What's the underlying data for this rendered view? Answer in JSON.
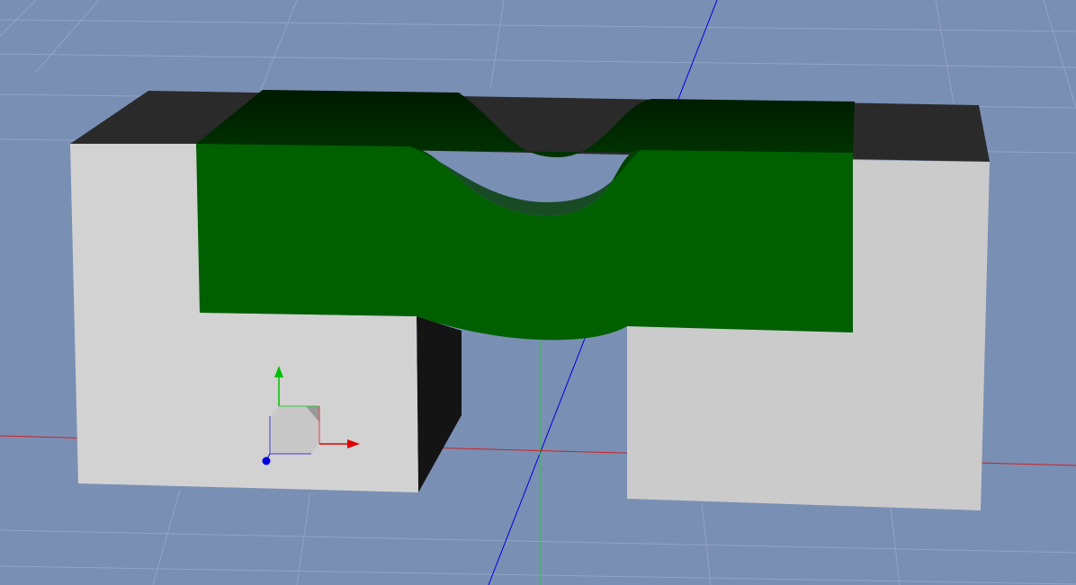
{
  "viewport": {
    "background_color": "#7a8fb4",
    "grid_color": "#93a5c4",
    "colors": {
      "block_face": "#d0d0d0",
      "block_top": "#2a2a2a",
      "block_side": "#141414",
      "part_front": "#006000",
      "part_top": "#002a00",
      "axis_x": "#e00000",
      "axis_y": "#00d000",
      "axis_z": "#0000e0"
    },
    "gizmo": {
      "icon": "axis-triad-icon"
    }
  }
}
